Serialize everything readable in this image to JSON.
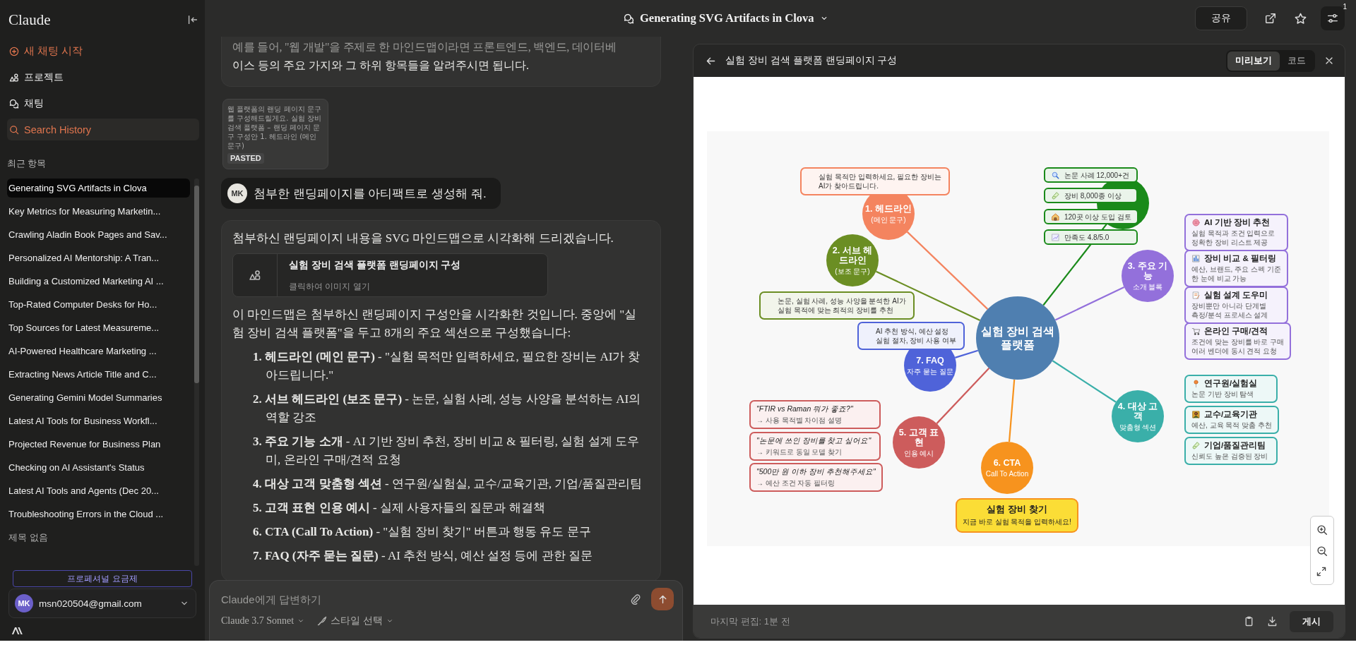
{
  "sidebar": {
    "logo": "Claude",
    "nav": [
      {
        "kind": "new-chat",
        "label": "새 채팅 시작",
        "selected": false
      },
      {
        "kind": "projects",
        "label": "프로젝트",
        "selected": false
      },
      {
        "kind": "chats",
        "label": "채팅",
        "selected": false
      },
      {
        "kind": "search",
        "label": "Search History",
        "selected": true
      }
    ],
    "recent_heading": "최근 항목",
    "recents": [
      {
        "title": "Generating SVG Artifacts in Clova",
        "selected": true
      },
      {
        "title": "Key Metrics for Measuring Marketin...",
        "selected": false
      },
      {
        "title": "Crawling Aladin Book Pages and Sav...",
        "selected": false
      },
      {
        "title": "Personalized AI Mentorship: A Tran...",
        "selected": false
      },
      {
        "title": "Building a Customized Marketing AI ...",
        "selected": false
      },
      {
        "title": "Top-Rated Computer Desks for Ho...",
        "selected": false
      },
      {
        "title": "Top Sources for Latest Measureme...",
        "selected": false
      },
      {
        "title": "AI-Powered Healthcare Marketing ...",
        "selected": false
      },
      {
        "title": "Extracting News Article Title and C...",
        "selected": false
      },
      {
        "title": "Generating Gemini Model Summaries",
        "selected": false
      },
      {
        "title": "Latest AI Tools for Business Workfl...",
        "selected": false
      },
      {
        "title": "Projected Revenue for Business Plan",
        "selected": false
      },
      {
        "title": "Checking on AI Assistant's Status",
        "selected": false
      },
      {
        "title": "Latest AI Tools and Agents (Dec 20...",
        "selected": false
      },
      {
        "title": "Troubleshooting Errors in the Cloud ...",
        "selected": false
      },
      {
        "title": "제목 없음",
        "selected": false
      }
    ],
    "plan_button": "프로페셔널 요금제",
    "account": {
      "initials": "MK",
      "email": "msn020504@gmail.com"
    }
  },
  "top_bar": {
    "title": "Generating SVG Artifacts in Clova",
    "share": "공유",
    "notification_count": "1"
  },
  "chat": {
    "earlier_reply": [
      "예를 들어, \"웹 개발\"을 주제로 한 마인드맵이라면 프론트엔드, 백엔드, 데이터베",
      "이스 등의 주요 가지와 그 하위 항목들을 알려주시면 됩니다."
    ],
    "pasted": {
      "preview": "웹 플랫폼의 랜딩 페이지 문구를 구성해드릴게요. 실험 장비 검색 플랫폼 – 랜딩 페이지 문구 구성안 1. 헤드라인 (메인 문구)",
      "label": "PASTED"
    },
    "user_message": {
      "initials": "MK",
      "text": "첨부한 랜딩페이지를 아티팩트로 생성해 줘."
    },
    "reply": {
      "intro": "첨부하신 랜딩페이지 내용을 SVG 마인드맵으로 시각화해 드리겠습니다.",
      "artifact_card": {
        "title": "실험 장비 검색 플랫폼 랜딩페이지 구성",
        "subtitle": "클릭하여 이미지 열기"
      },
      "paragraph": "이 마인드맵은 첨부하신 랜딩페이지 구성안을 시각화한 것입니다. 중앙에 \"실험 장비 검색 플랫폼\"을 두고 8개의 주요 섹션으로 구성했습니다:",
      "items": [
        "**1. 헤드라인 (메인 문구)** - \"실험 목적만 입력하세요, 필요한 장비는 AI가 찾아드립니다.\"",
        "**2. 서브 헤드라인 (보조 문구)** - 논문, 실험 사례, 성능 사양을 분석하는 AI의 역할 강조",
        "**3. 주요 기능 소개** - AI 기반 장비 추천, 장비 비교 & 필터링, 실험 설계 도우미, 온라인 구매/견적 요청",
        "**4. 대상 고객 맞춤형 섹션** - 연구원/실험실, 교수/교육기관, 기업/품질관리팀",
        "**5. 고객 표현 인용 예시** - 실제 사용자들의 질문과 해결책",
        "**6. CTA (Call To Action)** - \"실험 장비 찾기\" 버튼과 행동 유도 문구",
        "**7. FAQ (자주 묻는 질문)** - AI 추천 방식, 예산 설정 등에 관한 질문"
      ]
    },
    "composer": {
      "placeholder": "Claude에게 답변하기",
      "model": "Claude 3.7 Sonnet",
      "style": "스타일 선택"
    }
  },
  "artifact": {
    "title": "실험 장비 검색 플랫폼 랜딩페이지 구성",
    "tabs": [
      {
        "label": "미리보기",
        "selected": true
      },
      {
        "label": "코드",
        "selected": false
      }
    ],
    "mindmap": {
      "center": [
        "실험 장비 검색",
        "플랫폼"
      ],
      "branches": [
        {
          "title": "1. 헤드라인",
          "subtitle": "(메인 문구)",
          "color": "#f4845f",
          "notes": [
            {
              "kind": "callout",
              "lines": [
                "실험 목적만 입력하세요, 필요한 장비는",
                "AI가 찾아드립니다."
              ]
            }
          ]
        },
        {
          "title": "2. 서브 헤드라인",
          "subtitle": "(보조 문구)",
          "color": "#6b8e23",
          "notes": [
            {
              "kind": "callout",
              "lines": [
                "논문, 실험 사례, 성능 사양을 분석한 AI가",
                "실험 목적에 맞는 최적의 장비를 추천"
              ]
            }
          ]
        },
        {
          "title": "3. 주요 기능",
          "subtitle": "소개 블록",
          "color": "#9370db",
          "notes": [
            {
              "kind": "feature",
              "title": "AI 기반 장비 추천",
              "lines": [
                "실험 목적과 조건 입력으로",
                "정확한 장비 리스트 제공"
              ]
            },
            {
              "kind": "feature",
              "title": "장비 비교 & 필터링",
              "lines": [
                "예산, 브랜드, 주요 스펙 기준",
                "한 눈에 비교 가능"
              ]
            },
            {
              "kind": "feature",
              "title": "실험 설계 도우미",
              "lines": [
                "장비뿐만 아니라 단계별",
                "측정/분석 프로세스 설계"
              ]
            },
            {
              "kind": "feature",
              "title": "온라인 구매/견적",
              "lines": [
                "조건에 맞는 장비를 바로 구매",
                "여러 벤더에 동시 견적 요청"
              ]
            }
          ]
        },
        {
          "title": "4. 대상 고객",
          "subtitle": "맞춤형 섹션",
          "color": "#3aafa9",
          "notes": [
            {
              "kind": "feature",
              "title": "연구원/실험실",
              "lines": [
                "논문 기반 장비 탐색"
              ]
            },
            {
              "kind": "feature",
              "title": "교수/교육기관",
              "lines": [
                "예산, 교육 목적 맞춤 추천"
              ]
            },
            {
              "kind": "feature",
              "title": "기업/품질관리팀",
              "lines": [
                "신뢰도 높은 검증된 장비"
              ]
            }
          ]
        },
        {
          "title": "5. 고객 표현",
          "subtitle": "인용 예시",
          "color": "#cd5c5c",
          "notes": [
            {
              "kind": "quote",
              "title": "\"FTIR vs Raman 뭐가 좋죠?\"",
              "lines": [
                "→ 사용 목적별 차이점 설명"
              ]
            },
            {
              "kind": "quote",
              "title": "\"논문에 쓰인 장비를 찾고 싶어요\"",
              "lines": [
                "→ 키워드로 동일 모델 찾기"
              ]
            },
            {
              "kind": "quote",
              "title": "\"500만 원 이하 장비 추천해주세요\"",
              "lines": [
                "→ 예산 조건 자동 필터링"
              ]
            }
          ]
        },
        {
          "title": "6. CTA",
          "subtitle": "Call To Action",
          "color": "#f7931e",
          "notes": [
            {
              "kind": "cta",
              "title": "실험 장비 찾기",
              "lines": [
                "지금 바로 실험 목적을 입력하세요!"
              ]
            }
          ]
        },
        {
          "title": "7. FAQ",
          "subtitle": "자주 묻는 질문",
          "color": "#4f63d9",
          "notes": [
            {
              "kind": "callout",
              "lines": [
                "AI 추천 방식, 예산 설정",
                "실험 절차, 장비 사용 여부"
              ]
            }
          ]
        },
        {
          "color": "#1a8a1a",
          "notes": [
            {
              "kind": "stat",
              "lines": [
                "논문 사례 12,000+건"
              ]
            },
            {
              "kind": "stat",
              "lines": [
                "장비 8,000종 이상"
              ]
            },
            {
              "kind": "stat",
              "lines": [
                "120곳 이상 도입 검토"
              ]
            },
            {
              "kind": "stat",
              "lines": [
                "만족도 4.8/5.0"
              ]
            }
          ]
        }
      ]
    },
    "footer": "마지막 편집: 1분 전",
    "publish": "게시"
  }
}
